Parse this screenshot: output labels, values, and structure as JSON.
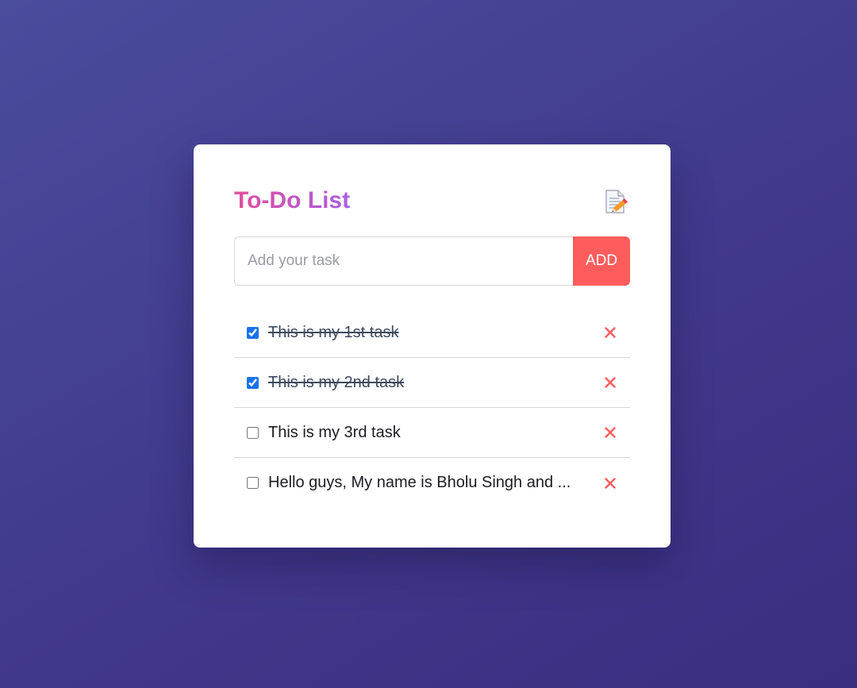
{
  "app": {
    "title": "To-Do List",
    "title_icon": "memo-pencil-icon"
  },
  "input": {
    "placeholder": "Add your task",
    "value": ""
  },
  "add_button": {
    "label": "ADD"
  },
  "tasks": [
    {
      "text": "This is my 1st task",
      "completed": true
    },
    {
      "text": "This is my 2nd task",
      "completed": true
    },
    {
      "text": "This is my 3rd task",
      "completed": false
    },
    {
      "text": "Hello guys, My name is Bholu Singh and ...",
      "completed": false
    }
  ],
  "colors": {
    "accent": "#ff5d5d",
    "title_gradient_start": "#e14f9d",
    "title_gradient_end": "#a85ee0",
    "checkbox": "#1a73e8",
    "background_start": "#4a4c9c",
    "background_end": "#3a2e80"
  },
  "icons": {
    "delete": "close-icon"
  }
}
